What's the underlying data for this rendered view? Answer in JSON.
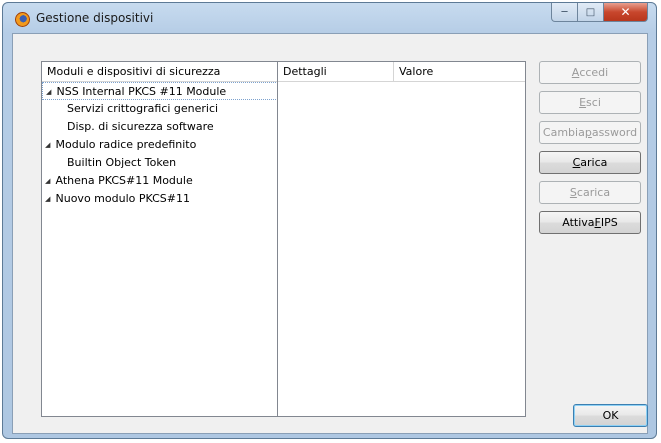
{
  "window": {
    "title": "Gestione dispositivi",
    "controls": {
      "minimize": "─",
      "maximize": "□",
      "close": "✕"
    }
  },
  "tree": {
    "header": "Moduli e dispositivi di sicurezza",
    "items": [
      {
        "label": "NSS Internal PKCS #11 Module",
        "level": 0,
        "expanded": true,
        "selected": true
      },
      {
        "label": "Servizi crittografici generici",
        "level": 1
      },
      {
        "label": "Disp. di sicurezza software",
        "level": 1
      },
      {
        "label": "Modulo radice predefinito",
        "level": 0,
        "expanded": true
      },
      {
        "label": "Builtin Object Token",
        "level": 1
      },
      {
        "label": "Athena PKCS#11 Module",
        "level": 0,
        "expanded": true
      },
      {
        "label": "Nuovo modulo PKCS#11",
        "level": 0,
        "expanded": true
      }
    ]
  },
  "details": {
    "col_details": "Dettagli",
    "col_value": "Valore"
  },
  "buttons": {
    "login": {
      "pre": "",
      "key": "A",
      "post": "ccedi",
      "enabled": false
    },
    "logout": {
      "pre": "",
      "key": "E",
      "post": "sci",
      "enabled": false
    },
    "change_password": {
      "pre": "Cambia ",
      "key": "p",
      "post": "assword",
      "enabled": false
    },
    "load": {
      "pre": "",
      "key": "C",
      "post": "arica",
      "enabled": true
    },
    "unload": {
      "pre": "",
      "key": "S",
      "post": "carica",
      "enabled": false
    },
    "fips": {
      "pre": "Attiva ",
      "key": "F",
      "post": "IPS",
      "enabled": true
    },
    "ok": "OK"
  },
  "colors": {
    "accent": "#3c7fb1",
    "disabled_text": "#9a9a9a",
    "window_frame": "#aec7e2"
  }
}
